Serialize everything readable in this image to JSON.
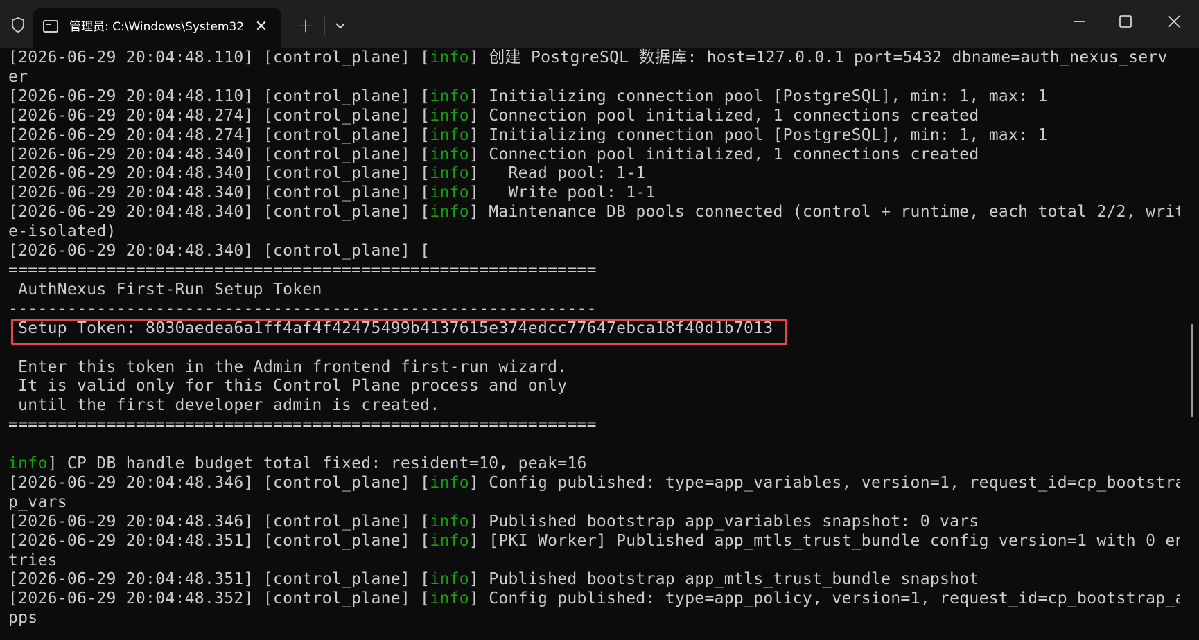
{
  "window": {
    "tab_title": "管理员: C:\\Windows\\System32",
    "tab_close": "✕",
    "new_tab": "+",
    "icons": [
      "shield-icon",
      "terminal-icon",
      "chevron-down-icon",
      "minimize-icon",
      "maximize-icon",
      "close-icon"
    ],
    "highlight_color": "#e8454d",
    "info_color": "#13a10e",
    "text_color": "#cccccc"
  },
  "log_lines": [
    {
      "prefix": "[2026-06-29 20:04:48.110] [control_plane] [",
      "tag": "info",
      "msg": "] 创建 PostgreSQL 数据库: host=127.0.0.1 port=5432 dbname=auth_nexus_serv"
    },
    {
      "prefix": "er",
      "tag": "",
      "msg": ""
    },
    {
      "prefix": "[2026-06-29 20:04:48.110] [control_plane] [",
      "tag": "info",
      "msg": "] Initializing connection pool [PostgreSQL], min: 1, max: 1"
    },
    {
      "prefix": "[2026-06-29 20:04:48.274] [control_plane] [",
      "tag": "info",
      "msg": "] Connection pool initialized, 1 connections created"
    },
    {
      "prefix": "[2026-06-29 20:04:48.274] [control_plane] [",
      "tag": "info",
      "msg": "] Initializing connection pool [PostgreSQL], min: 1, max: 1"
    },
    {
      "prefix": "[2026-06-29 20:04:48.340] [control_plane] [",
      "tag": "info",
      "msg": "] Connection pool initialized, 1 connections created"
    },
    {
      "prefix": "[2026-06-29 20:04:48.340] [control_plane] [",
      "tag": "info",
      "msg": "]   Read pool: 1-1"
    },
    {
      "prefix": "[2026-06-29 20:04:48.340] [control_plane] [",
      "tag": "info",
      "msg": "]   Write pool: 1-1"
    },
    {
      "prefix": "[2026-06-29 20:04:48.340] [control_plane] [",
      "tag": "info",
      "msg": "] Maintenance DB pools connected (control + runtime, each total 2/2, writ"
    },
    {
      "prefix": "e-isolated)",
      "tag": "",
      "msg": ""
    },
    {
      "prefix": "[2026-06-29 20:04:48.340] [control_plane] [",
      "tag": "",
      "msg": ""
    },
    {
      "prefix": "============================================================",
      "tag": "",
      "msg": ""
    },
    {
      "prefix": " AuthNexus First-Run Setup Token",
      "tag": "",
      "msg": ""
    },
    {
      "prefix": "------------------------------------------------------------",
      "tag": "",
      "msg": ""
    },
    {
      "prefix": " Setup Token: 8030aedea6a1ff4af4f42475499b4137615e374edcc77647ebca18f40d1b7013",
      "tag": "",
      "msg": ""
    },
    {
      "prefix": "",
      "tag": "",
      "msg": ""
    },
    {
      "prefix": " Enter this token in the Admin frontend first-run wizard.",
      "tag": "",
      "msg": ""
    },
    {
      "prefix": " It is valid only for this Control Plane process and only",
      "tag": "",
      "msg": ""
    },
    {
      "prefix": " until the first developer admin is created.",
      "tag": "",
      "msg": ""
    },
    {
      "prefix": "============================================================",
      "tag": "",
      "msg": ""
    },
    {
      "prefix": "",
      "tag": "",
      "msg": ""
    },
    {
      "prefix": "",
      "tag": "info",
      "msg": "] CP DB handle budget total fixed: resident=10, peak=16"
    },
    {
      "prefix": "[2026-06-29 20:04:48.346] [control_plane] [",
      "tag": "info",
      "msg": "] Config published: type=app_variables, version=1, request_id=cp_bootstra"
    },
    {
      "prefix": "p_vars",
      "tag": "",
      "msg": ""
    },
    {
      "prefix": "[2026-06-29 20:04:48.346] [control_plane] [",
      "tag": "info",
      "msg": "] Published bootstrap app_variables snapshot: 0 vars"
    },
    {
      "prefix": "[2026-06-29 20:04:48.351] [control_plane] [",
      "tag": "info",
      "msg": "] [PKI Worker] Published app_mtls_trust_bundle config version=1 with 0 en"
    },
    {
      "prefix": "tries",
      "tag": "",
      "msg": ""
    },
    {
      "prefix": "[2026-06-29 20:04:48.351] [control_plane] [",
      "tag": "info",
      "msg": "] Published bootstrap app_mtls_trust_bundle snapshot"
    },
    {
      "prefix": "[2026-06-29 20:04:48.352] [control_plane] [",
      "tag": "info",
      "msg": "] Config published: type=app_policy, version=1, request_id=cp_bootstrap_a"
    },
    {
      "prefix": "pps",
      "tag": "",
      "msg": ""
    }
  ]
}
